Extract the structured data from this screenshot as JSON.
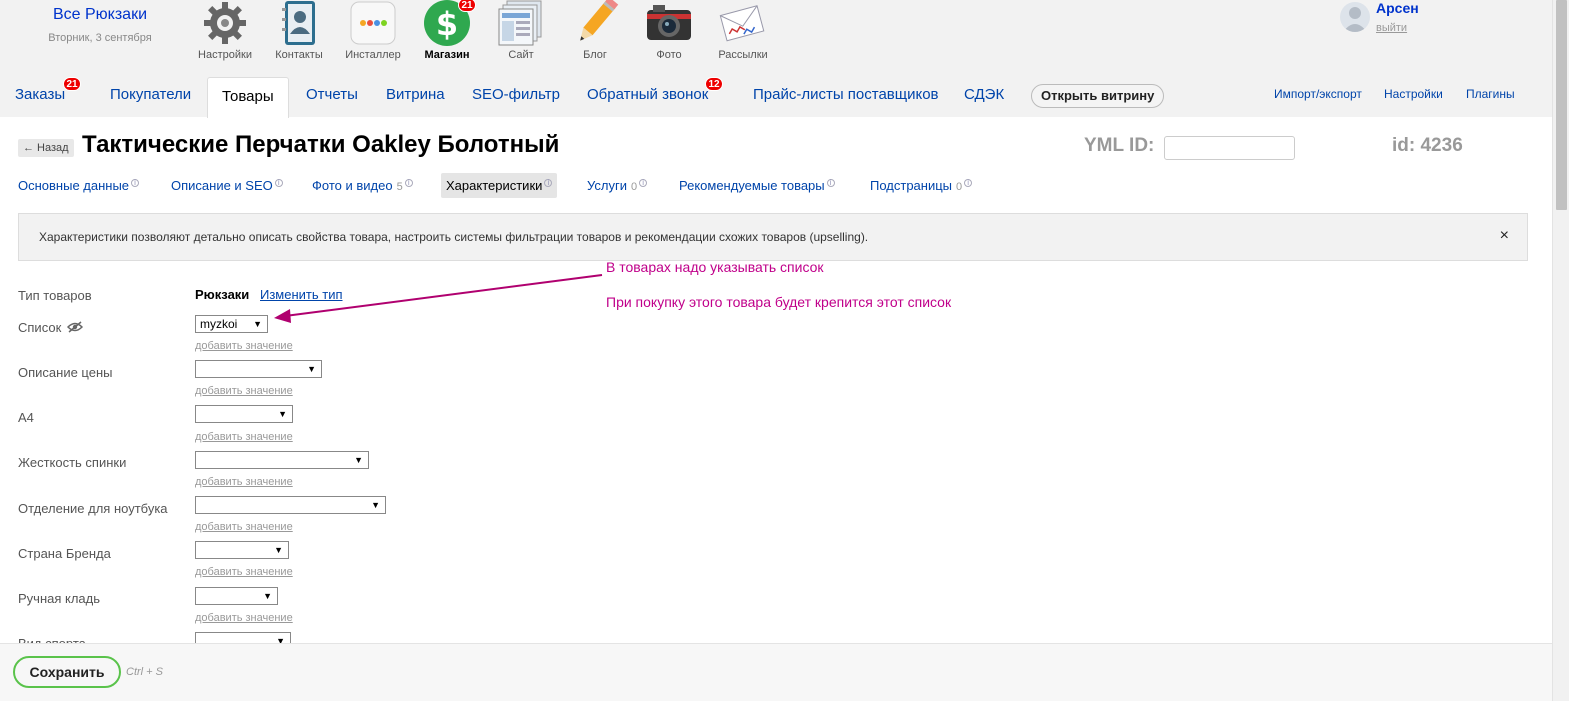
{
  "account": {
    "name": "Все Рюкзаки",
    "date": "Вторник, 3 сентября"
  },
  "apps": [
    {
      "label": "Настройки",
      "icon": "gear-icon"
    },
    {
      "label": "Контакты",
      "icon": "contacts-book-icon"
    },
    {
      "label": "Инсталлер",
      "icon": "installer-icon"
    },
    {
      "label": "Магазин",
      "icon": "shop-dollar-icon",
      "badge": "21",
      "active": true
    },
    {
      "label": "Сайт",
      "icon": "site-pages-icon"
    },
    {
      "label": "Блог",
      "icon": "pencil-icon"
    },
    {
      "label": "Фото",
      "icon": "camera-icon"
    },
    {
      "label": "Рассылки",
      "icon": "mail-letters-icon"
    }
  ],
  "user": {
    "name": "Арсен",
    "logout": "выйти"
  },
  "nav": {
    "tabs": [
      {
        "label": "Заказы",
        "badge": "21"
      },
      {
        "label": "Покупатели"
      },
      {
        "label": "Товары",
        "active": true
      },
      {
        "label": "Отчеты"
      },
      {
        "label": "Витрина"
      },
      {
        "label": "SEO-фильтр"
      },
      {
        "label": "Обратный звонок",
        "badge": "12"
      },
      {
        "label": "Прайс-листы поставщиков"
      },
      {
        "label": "СДЭК"
      }
    ],
    "open_storefront": "Открыть витрину",
    "right": [
      "Импорт/экспорт",
      "Настройки",
      "Плагины"
    ]
  },
  "product": {
    "back": "← Назад",
    "title": "Тактические Перчатки Oakley Болотный",
    "yml_label": "YML ID:",
    "yml_value": "",
    "id_text": "id: 4236"
  },
  "subtabs": [
    {
      "label": "Основные данные",
      "count": "",
      "info": true
    },
    {
      "label": "Описание и SEO",
      "count": "",
      "info": true
    },
    {
      "label": "Фото и видео",
      "count": "5",
      "info": true
    },
    {
      "label": "Характеристики",
      "count": "",
      "info": true,
      "active": true
    },
    {
      "label": "Услуги",
      "count": "0",
      "info": true
    },
    {
      "label": "Рекомендуемые товары",
      "count": "",
      "info": true
    },
    {
      "label": "Подстраницы",
      "count": "0",
      "info": true
    }
  ],
  "notice": {
    "text": "Характеристики позволяют детально описать свойства товара, настроить системы фильтрации товаров и рекомендации схожих товаров (upselling).",
    "close": "×"
  },
  "annotations": {
    "line1": "В товарах надо указывать список",
    "line2": "При покупку этого товара будет крепится этот список"
  },
  "features": {
    "type_label": "Тип товаров",
    "type_value": "Рюкзаки",
    "change_type": "Изменить тип",
    "add_value": "добавить значение",
    "rows": [
      {
        "label": "Список",
        "value": "myzkoi",
        "hidden_icon": "eye-slash-icon"
      },
      {
        "label": "Описание цены",
        "value": ""
      },
      {
        "label": "А4",
        "value": ""
      },
      {
        "label": "Жесткость спинки",
        "value": ""
      },
      {
        "label": "Отделение для ноутбука",
        "value": ""
      },
      {
        "label": "Страна Бренда",
        "value": ""
      },
      {
        "label": "Ручная кладь",
        "value": ""
      },
      {
        "label": "Вид спорта",
        "value": ""
      }
    ]
  },
  "footer": {
    "save": "Сохранить",
    "shortcut": "Ctrl + S"
  },
  "colors": {
    "link": "#0044aa",
    "badge": "#e00000",
    "annotation": "#c0008a",
    "save_border": "#5ac34b"
  }
}
